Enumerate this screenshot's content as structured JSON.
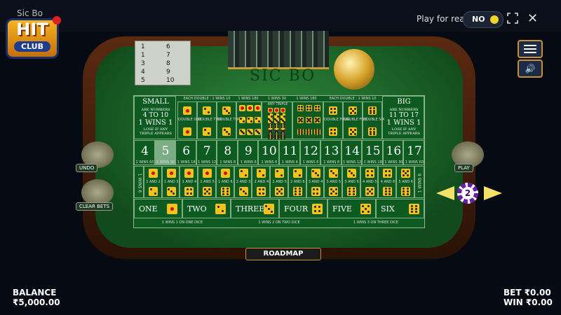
{
  "window": {
    "title": "Sic Bo"
  },
  "logo": {
    "hit": "HIT",
    "club": "CLUB"
  },
  "header": {
    "play_for_real": "Play for real",
    "toggle": "NO",
    "close": "✕"
  },
  "history": [
    [
      "1",
      "6"
    ],
    [
      "1",
      "7"
    ],
    [
      "3",
      "8"
    ],
    [
      "4",
      "9"
    ],
    [
      "5",
      "10"
    ]
  ],
  "table": {
    "title": "SIC BO",
    "roadmap": "ROADMAP"
  },
  "small": {
    "title": "SMALL",
    "l1": "ARE NUMBERS",
    "l2": "4 TO 10",
    "l3": "1 WINS 1",
    "l4": "LOSE IF ANY",
    "l5": "TRIPLE APPEARS"
  },
  "big": {
    "title": "BIG",
    "l1": "ARE NUMBERS",
    "l2": "11 TO 17",
    "l3": "1 WINS 1",
    "l4": "LOSE IF ANY",
    "l5": "TRIPLE APPEARS"
  },
  "headers": {
    "each_double_left": "EACH DOUBLE : 1 WINS 10",
    "each_double_right": "EACH DOUBLE : 1 WINS 10",
    "wins180a": "1 WINS 180",
    "wins30": "1 WINS 30",
    "wins180b": "1 WINS 180",
    "any_triple": "ANY TRIPLE"
  },
  "doubles_left": [
    "DOUBLE ONE",
    "DOUBLE TWO",
    "DOUBLE THREE"
  ],
  "doubles_right": [
    "DOUBLE FOUR",
    "DOUBLE FIVE",
    "DOUBLE SIX"
  ],
  "totals": [
    {
      "n": "4",
      "p": "1 WINS 60"
    },
    {
      "n": "5",
      "p": "1 WINS 30"
    },
    {
      "n": "6",
      "p": "1 WINS 18"
    },
    {
      "n": "7",
      "p": "1 WINS 12"
    },
    {
      "n": "8",
      "p": "1 WINS 8"
    },
    {
      "n": "9",
      "p": "1 WINS 6"
    },
    {
      "n": "10",
      "p": "1 WINS 6"
    },
    {
      "n": "11",
      "p": "1 WINS 6"
    },
    {
      "n": "12",
      "p": "1 WINS 6"
    },
    {
      "n": "13",
      "p": "1 WINS 8"
    },
    {
      "n": "14",
      "p": "1 WINS 12"
    },
    {
      "n": "15",
      "p": "1 WINS 18"
    },
    {
      "n": "16",
      "p": "1 WINS 30"
    },
    {
      "n": "17",
      "p": "1 WINS 60"
    }
  ],
  "combos_label": "1 WINS 6",
  "combos": [
    "1 AND 2",
    "1 AND 3",
    "1 AND 4",
    "1 AND 5",
    "1 AND 6",
    "2 AND 3",
    "2 AND 4",
    "2 AND 5",
    "2 AND 6",
    "3 AND 4",
    "3 AND 5",
    "3 AND 6",
    "4 AND 5",
    "4 AND 6",
    "5 AND 6"
  ],
  "singles": [
    "ONE",
    "TWO",
    "THREE",
    "FOUR",
    "FIVE",
    "SIX"
  ],
  "single_pay": [
    "1 WINS 1 ON ONE DICE",
    "1 WINS 2 ON TWO DICE",
    "1 WINS 3 ON THREE DICE"
  ],
  "side": {
    "undo": "UNDO",
    "clear": "CLEAR BETS",
    "play": "PLAY"
  },
  "chip": {
    "value": "2"
  },
  "footer": {
    "balance_label": "BALANCE",
    "balance_value": "₹5,000.00",
    "bet": "BET ₹0.00",
    "win": "WIN ₹0.00"
  }
}
